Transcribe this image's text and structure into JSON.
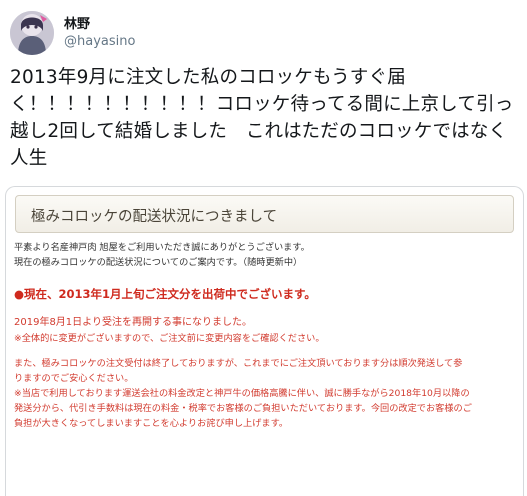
{
  "user": {
    "display_name": "林野",
    "handle": "@hayasino"
  },
  "tweet": {
    "text": "2013年9月に注文した私のコロッケもうすぐ届く！！！！！！！！！！コロッケ待ってる間に上京して引っ越し2回して結婚しました　これはただのコロッケではなく人生"
  },
  "notice": {
    "title": "極みコロッケの配送状況につきまして",
    "intro": [
      "平素より名産神戸肉 旭屋をご利用いただき誠にありがとうございます。",
      "現在の極みコロッケの配送状況についてのご案内です。（随時更新中）"
    ],
    "status": "●現在、2013年1月上旬ご注文分を出荷中でございます。",
    "resume": "2019年8月1日より受注を再開する事になりました。",
    "change_notice": "※全体的に変更がございますので、ご注文前に変更内容をご確認ください。",
    "closed": [
      "また、極みコロッケの注文受付は終了しておりますが、これまでにご注文頂いております分は順次発送して参",
      "りますのでご安心ください。"
    ],
    "fee": [
      "※当店で利用しております運送会社の料金改定と神戸牛の価格高騰に伴い、誠に勝手ながら2018年10月以降の",
      "発送分から、代引き手数料は現在の料金・税率でお客様のご負担いただいております。今回の改定でお客様のご",
      "負担が大きくなってしまいますことを心よりお詫び申し上げます。"
    ]
  }
}
